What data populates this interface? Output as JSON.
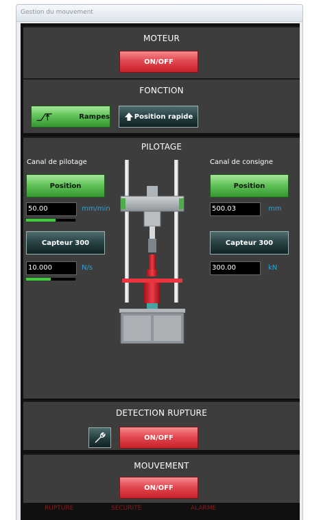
{
  "window": {
    "title": "Gestion du mouvement"
  },
  "moteur": {
    "title": "MOTEUR",
    "toggle_label": "ON/OFF"
  },
  "fonction": {
    "title": "FONCTION",
    "rampes_label": "Rampes",
    "position_rapide_label": "Position rapide"
  },
  "pilotage": {
    "title": "PILOTAGE",
    "left": {
      "channel_label": "Canal de pilotage",
      "mode_button": "Position",
      "value1": "50.00",
      "unit1": "mm/min",
      "progress1": 0.6,
      "sensor_button": "Capteur 300",
      "value2": "10.000",
      "unit2": "N/s",
      "progress2": 0.5
    },
    "right": {
      "channel_label": "Canal de consigne",
      "mode_button": "Position",
      "value1": "500.03",
      "unit1": "mm",
      "sensor_button": "Capteur 300",
      "value2": "300.00",
      "unit2": "kN"
    }
  },
  "detection": {
    "title": "DETECTION RUPTURE",
    "toggle_label": "ON/OFF",
    "tool_icon": "wrench-icon"
  },
  "mouvement": {
    "title": "MOUVEMENT",
    "toggle_label": "ON/OFF"
  },
  "status_bar": {
    "rupture": "RUPTURE",
    "securite": "SÉCURITÉ",
    "alarme": "ALARME"
  },
  "colors": {
    "panel_bg": "#3d3d3d",
    "accent_red": "#e24a51",
    "accent_green": "#62c35a",
    "unit_blue": "#2aa5d6",
    "status_red": "#8b1a1a"
  }
}
